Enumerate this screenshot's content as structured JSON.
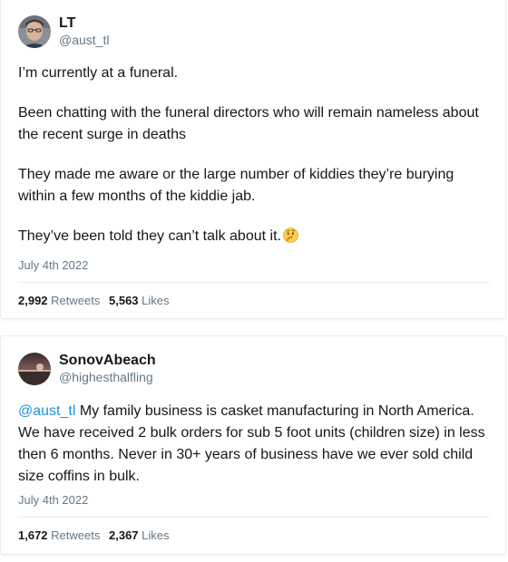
{
  "tweets": [
    {
      "display_name": "LT",
      "handle": "@aust_tl",
      "paragraphs": [
        "I’m currently at a funeral.",
        "Been chatting with the funeral directors who will remain nameless about the recent surge in deaths",
        "They made me aware or the large number of kiddies they’re burying within a few months of the kiddie jab.",
        "They’ve been told they can’t talk about it."
      ],
      "emoji": "thinking-face-emoji",
      "date": "July 4th 2022",
      "retweets_count": "2,992",
      "retweets_label": "Retweets",
      "likes_count": "5,563",
      "likes_label": "Likes"
    },
    {
      "display_name": "SonovAbeach",
      "handle": "@highesthalfling",
      "mention": "@aust_tl",
      "text": " My family business is casket manufacturing in North America. We have received 2 bulk orders for sub 5 foot units (children size) in less then 6 months. Never in 30+ years of business have we ever sold child size coffins in bulk.",
      "date": "July 4th 2022",
      "retweets_count": "1,672",
      "retweets_label": "Retweets",
      "likes_count": "2,367",
      "likes_label": "Likes"
    }
  ],
  "colors": {
    "text": "#14171a",
    "secondary": "#657786",
    "link": "#1b95e0",
    "border": "#e6ecf0"
  }
}
